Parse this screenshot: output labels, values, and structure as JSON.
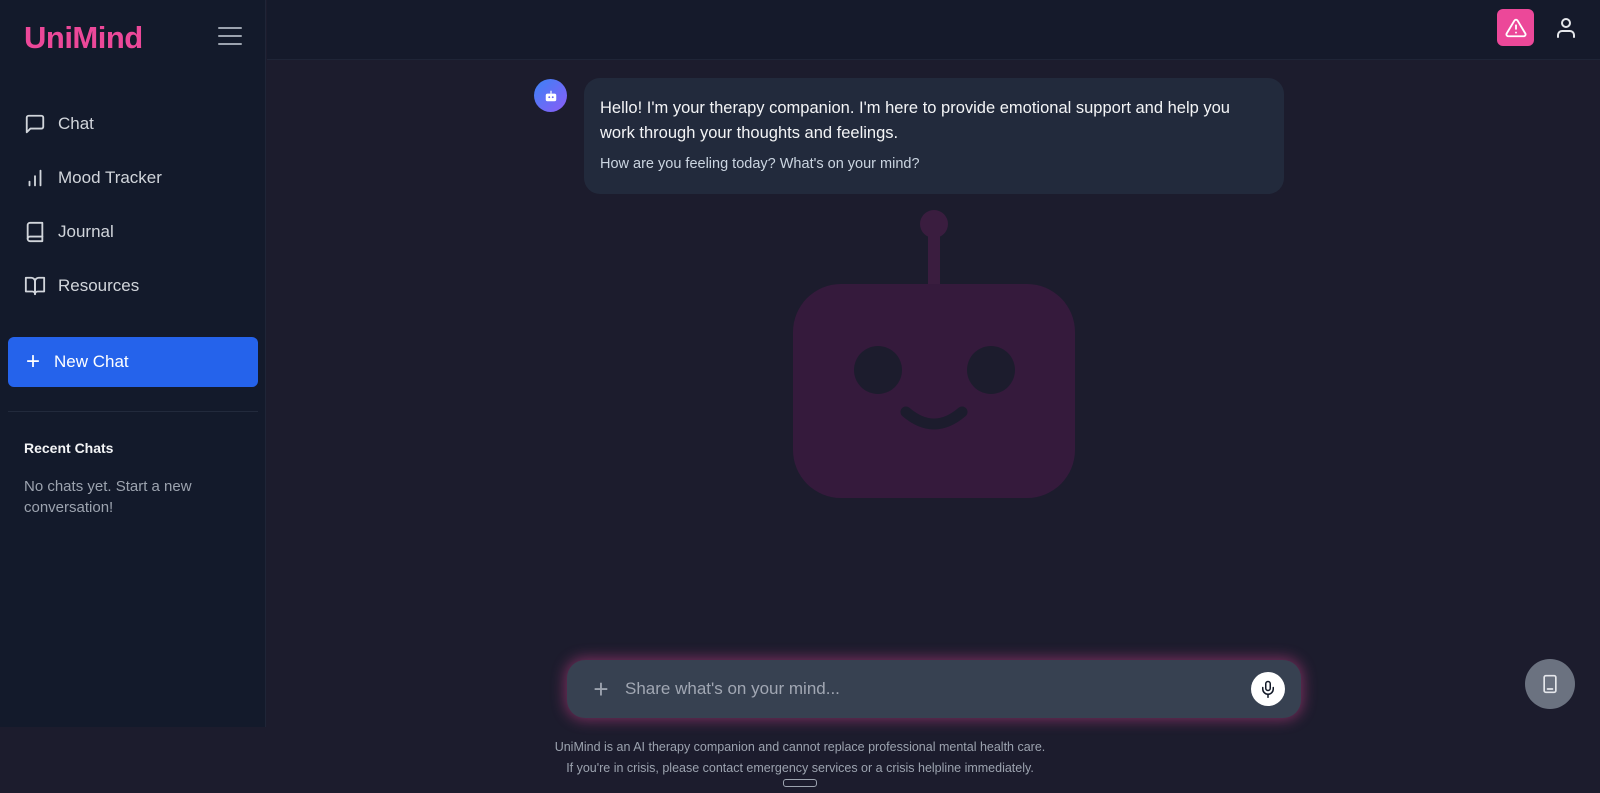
{
  "app": {
    "brand": "UniMind",
    "colors": {
      "brand": "#ec4899",
      "primary": "#2563eb",
      "alert": "#ec4899"
    }
  },
  "sidebar": {
    "items": [
      {
        "label": "Chat",
        "icon": "message-square-icon"
      },
      {
        "label": "Mood Tracker",
        "icon": "bar-chart-icon"
      },
      {
        "label": "Journal",
        "icon": "book-icon"
      },
      {
        "label": "Resources",
        "icon": "book-open-icon"
      }
    ],
    "new_chat_label": "New Chat",
    "recent_title": "Recent Chats",
    "recent_empty": "No chats yet. Start a new conversation!"
  },
  "topbar": {
    "alert_icon": "alert-triangle-icon",
    "user_icon": "user-icon"
  },
  "chat": {
    "messages": [
      {
        "role": "bot",
        "text": "Hello! I'm your therapy companion. I'm here to provide emotional support and help you work through your thoughts and feelings.",
        "subtext": "How are you feeling today? What's on your mind?"
      }
    ],
    "input_placeholder": "Share what's on your mind...",
    "input_value": ""
  },
  "footer": {
    "disclaimer_line1": "UniMind is an AI therapy companion and cannot replace professional mental health care.",
    "disclaimer_line2": "If you're in crisis, please contact emergency services or a crisis helpline immediately."
  }
}
